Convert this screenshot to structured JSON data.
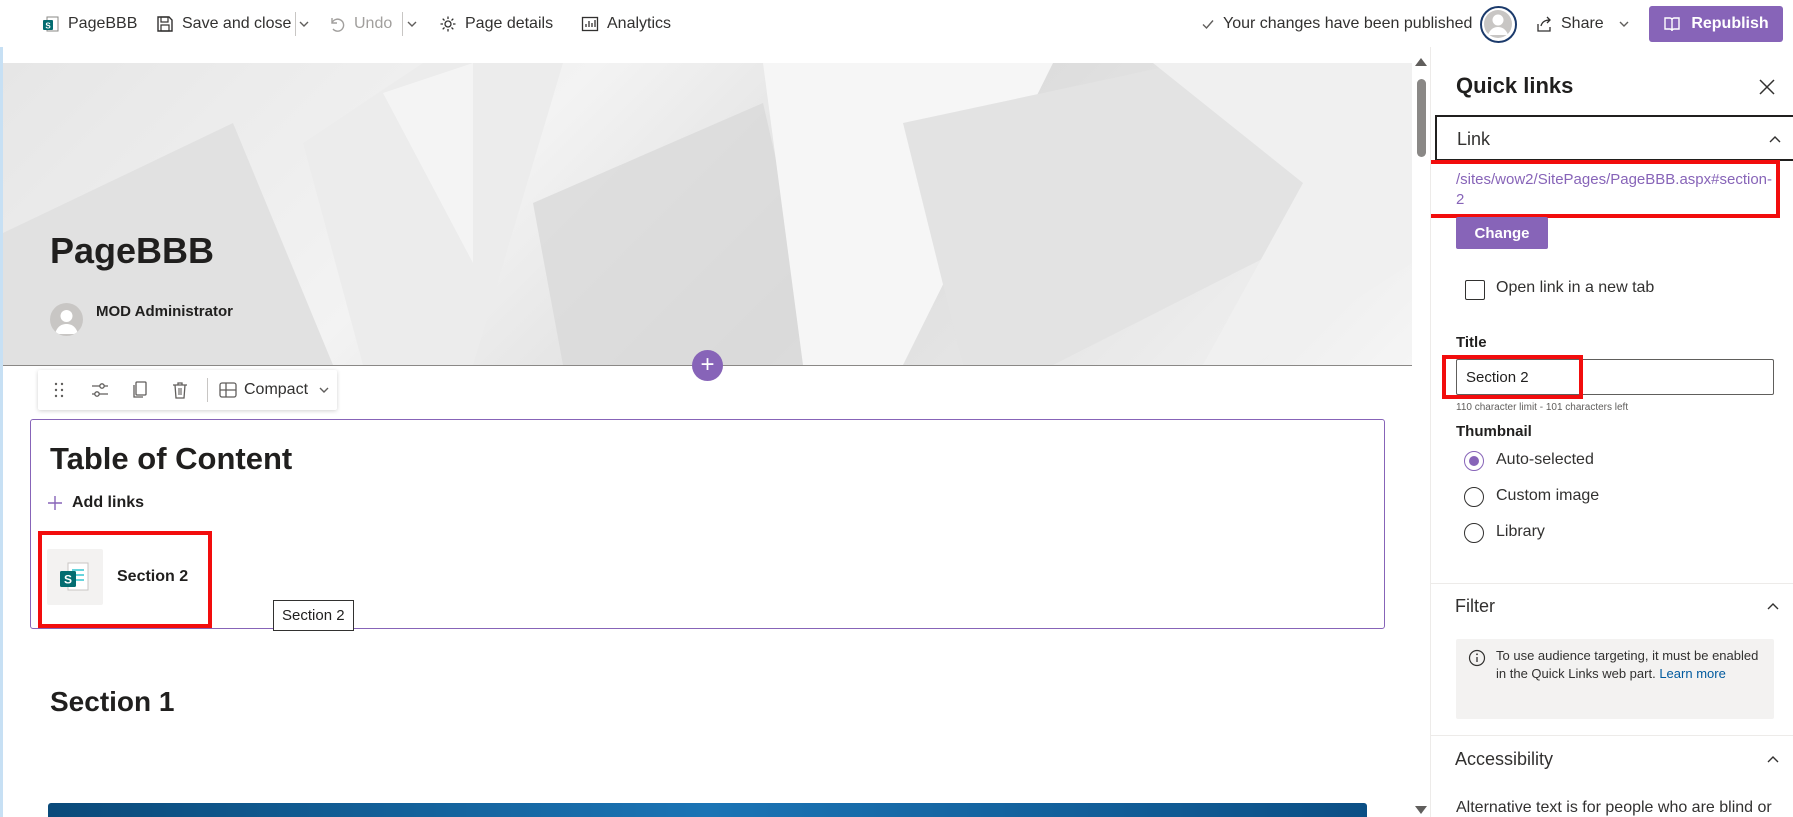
{
  "toolbar": {
    "page_name": "PageBBB",
    "save_close": "Save and close",
    "undo": "Undo",
    "page_details": "Page details",
    "analytics": "Analytics",
    "status": "Your changes have been published",
    "share": "Share",
    "republish": "Republish"
  },
  "page": {
    "title": "PageBBB",
    "author": "MOD Administrator"
  },
  "webpart_toolbar": {
    "layout": "Compact"
  },
  "webpart": {
    "title": "Table of Content",
    "add_links": "Add links",
    "links": [
      {
        "label": "Section 2"
      }
    ],
    "tooltip": "Section 2"
  },
  "content": {
    "section1_heading": "Section 1"
  },
  "pane": {
    "title": "Quick links",
    "link_group": "Link",
    "url": "/sites/wow2/SitePages/PageBBB.aspx#section-2",
    "change_button": "Change",
    "open_new_tab": "Open link in a new tab",
    "title_label": "Title",
    "title_value": "Section 2",
    "char_limit": "110 character limit - 101 characters left",
    "thumbnail_label": "Thumbnail",
    "thumbnail_options": [
      "Auto-selected",
      "Custom image",
      "Library"
    ],
    "thumbnail_selected": "Auto-selected",
    "filter_group": "Filter",
    "filter_note": "To use audience targeting, it must be enabled in the Quick Links web part.",
    "learn_more": "Learn more",
    "accessibility_group": "Accessibility",
    "alt_text": "Alternative text is for people who are blind or"
  },
  "colors": {
    "accent": "#8764b8",
    "highlight": "#f20d0d",
    "link": "#005a9e"
  },
  "icons": [
    "sharepoint-page-icon",
    "save-icon",
    "chevron-down-icon",
    "undo-icon",
    "gear-icon",
    "analytics-icon",
    "check-icon",
    "user-avatar-icon",
    "share-icon",
    "republish-icon",
    "drag-handle-icon",
    "settings-sliders-icon",
    "duplicate-icon",
    "delete-icon",
    "layout-icon",
    "plus-icon",
    "close-icon",
    "chevron-up-icon",
    "info-icon"
  ]
}
